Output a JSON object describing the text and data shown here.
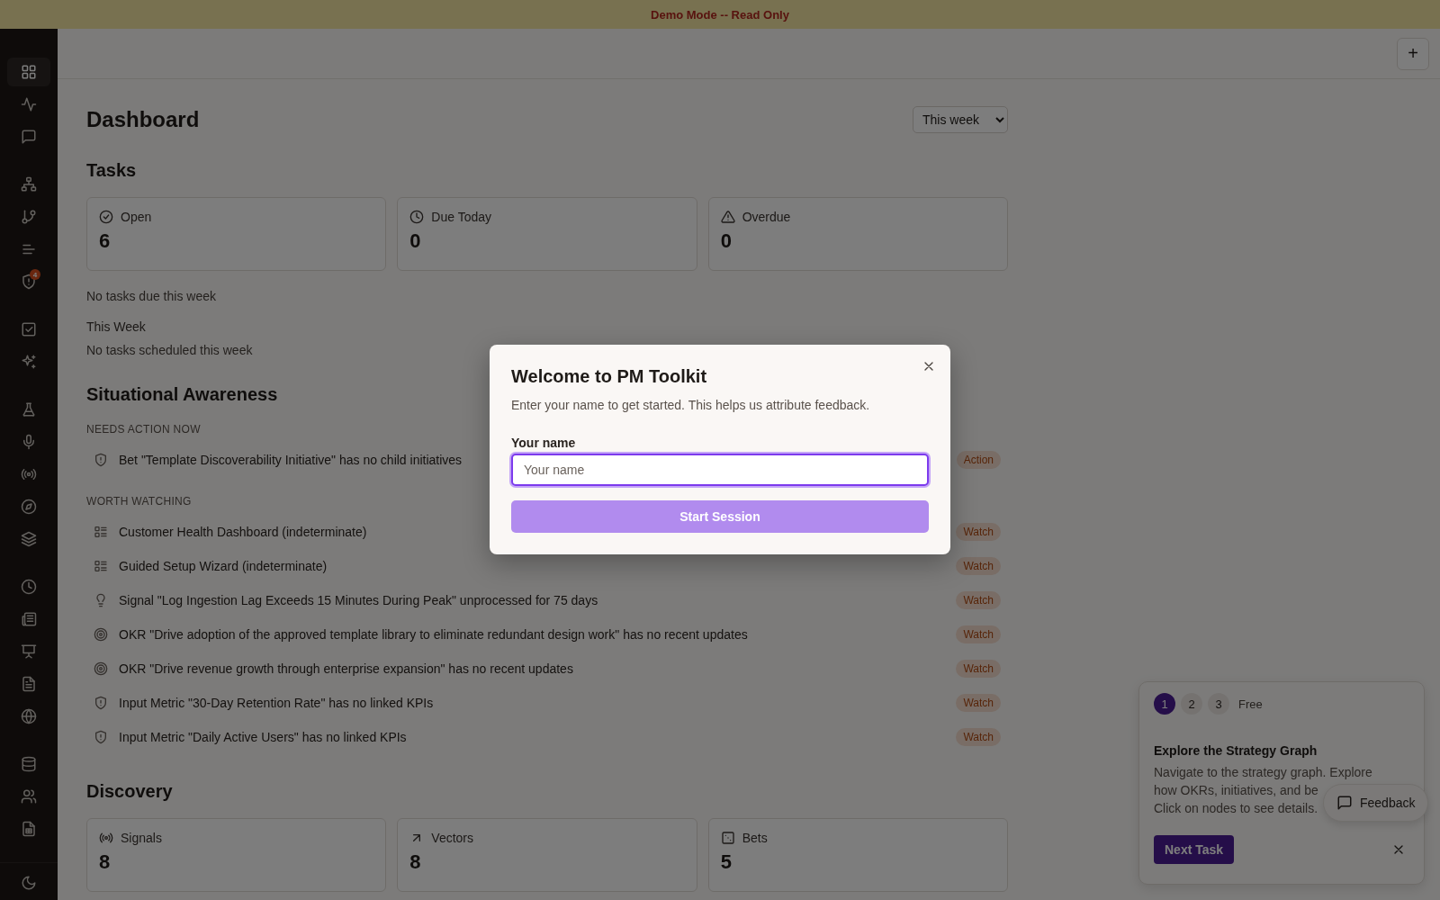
{
  "banner": {
    "text": "Demo Mode -- Read Only"
  },
  "sidebar": {
    "groups": [
      [
        {
          "kind": "grid",
          "selected": true
        },
        {
          "kind": "activity",
          "selected": false
        },
        {
          "kind": "message",
          "selected": false
        }
      ],
      [
        {
          "kind": "hierarchy",
          "selected": false
        },
        {
          "kind": "branch",
          "selected": false
        },
        {
          "kind": "lines",
          "selected": false
        },
        {
          "kind": "shield",
          "selected": false,
          "badge": "4"
        }
      ],
      [
        {
          "kind": "checkbox",
          "selected": false
        },
        {
          "kind": "sparkles",
          "selected": false
        }
      ],
      [
        {
          "kind": "flask",
          "selected": false
        },
        {
          "kind": "mic",
          "selected": false
        },
        {
          "kind": "radio",
          "selected": false
        },
        {
          "kind": "compass",
          "selected": false
        },
        {
          "kind": "layers",
          "selected": false
        }
      ],
      [
        {
          "kind": "clock",
          "selected": false
        },
        {
          "kind": "newspaper",
          "selected": false
        },
        {
          "kind": "presentation",
          "selected": false
        },
        {
          "kind": "document",
          "selected": false
        },
        {
          "kind": "globe",
          "selected": false
        }
      ],
      [
        {
          "kind": "database",
          "selected": false
        },
        {
          "kind": "users",
          "selected": false
        },
        {
          "kind": "sheet",
          "selected": false
        }
      ]
    ],
    "footer": {
      "kind": "moon"
    }
  },
  "header": {
    "add_button": "+"
  },
  "dashboard": {
    "title": "Dashboard",
    "period": "This week",
    "tasks": {
      "heading": "Tasks",
      "cards": [
        {
          "kind": "check-circle",
          "label": "Open",
          "value": "6"
        },
        {
          "kind": "clock",
          "label": "Due Today",
          "value": "0"
        },
        {
          "kind": "alert",
          "label": "Overdue",
          "value": "0"
        }
      ],
      "empty_due": "No tasks due this week",
      "week_heading": "This Week",
      "empty_week": "No tasks scheduled this week"
    },
    "situational": {
      "heading": "Situational Awareness",
      "groups": [
        {
          "title": "NEEDS ACTION NOW",
          "items": [
            {
              "kind": "shield",
              "text": "Bet \"Template Discoverability Initiative\" has no child initiatives",
              "badge": "Action"
            }
          ]
        },
        {
          "title": "WORTH WATCHING",
          "items": [
            {
              "kind": "list",
              "text": "Customer Health Dashboard (indeterminate)",
              "badge": "Watch"
            },
            {
              "kind": "list",
              "text": "Guided Setup Wizard (indeterminate)",
              "badge": "Watch"
            },
            {
              "kind": "bulb",
              "text": "Signal \"Log Ingestion Lag Exceeds 15 Minutes During Peak\" unprocessed for 75 days",
              "badge": "Watch"
            },
            {
              "kind": "target",
              "text": "OKR \"Drive adoption of the approved template library to eliminate redundant design work\" has no recent updates",
              "badge": "Watch"
            },
            {
              "kind": "target",
              "text": "OKR \"Drive revenue growth through enterprise expansion\" has no recent updates",
              "badge": "Watch"
            },
            {
              "kind": "shield",
              "text": "Input Metric \"30-Day Retention Rate\" has no linked KPIs",
              "badge": "Watch"
            },
            {
              "kind": "shield",
              "text": "Input Metric \"Daily Active Users\" has no linked KPIs",
              "badge": "Watch"
            }
          ]
        }
      ]
    },
    "discovery": {
      "heading": "Discovery",
      "cards": [
        {
          "kind": "radio",
          "label": "Signals",
          "value": "8"
        },
        {
          "kind": "arrow",
          "label": "Vectors",
          "value": "8"
        },
        {
          "kind": "dice",
          "label": "Bets",
          "value": "5"
        }
      ]
    }
  },
  "modal": {
    "title": "Welcome to PM Toolkit",
    "description": "Enter your name to get started. This helps us attribute feedback.",
    "field_label": "Your name",
    "placeholder": "Your name",
    "button": "Start Session"
  },
  "walkthrough": {
    "steps": [
      {
        "label": "1",
        "selected": true
      },
      {
        "label": "2",
        "selected": false
      },
      {
        "label": "3",
        "selected": false
      }
    ],
    "free": "Free",
    "title": "Explore the Strategy Graph",
    "lines": [
      "Navigate to the strategy graph. Explore",
      "how OKRs, initiatives, and be",
      "Click on nodes to see details."
    ],
    "button": "Next Task"
  },
  "feedback": {
    "label": "Feedback"
  }
}
